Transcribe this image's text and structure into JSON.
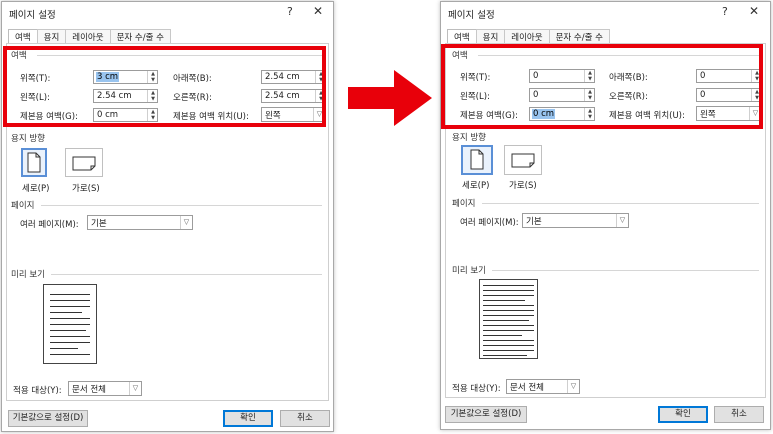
{
  "colors": {
    "highlight": "#e8000a",
    "arrow": "#e8000a",
    "selected_text": "#99c4ef",
    "default_button_border": "#0078d7"
  },
  "left_dialog": {
    "title": "페이지 설정",
    "help": "?",
    "close": "✕",
    "tabs": [
      "여백",
      "용지",
      "레이아웃",
      "문자 수/줄 수"
    ],
    "margins": {
      "group": "여백",
      "top_label": "위쪽(T):",
      "top_value": "3 cm",
      "bottom_label": "아래쪽(B):",
      "bottom_value": "2.54 cm",
      "left_label": "왼쪽(L):",
      "left_value": "2.54 cm",
      "right_label": "오른쪽(R):",
      "right_value": "2.54 cm",
      "gutter_label": "제본용 여백(G):",
      "gutter_value": "0 cm",
      "gutter_pos_label": "제본용 여백 위치(U):",
      "gutter_pos_value": "왼쪽"
    },
    "orientation": {
      "group": "용지 방향",
      "portrait": "세로(P)",
      "landscape": "가로(S)"
    },
    "pages": {
      "group": "페이지",
      "multiple_label": "여러 페이지(M):",
      "multiple_value": "기본"
    },
    "preview": {
      "group": "미리 보기"
    },
    "apply_label": "적용 대상(Y):",
    "apply_value": "문서 전체",
    "default_button": "기본값으로 설정(D)",
    "ok": "확인",
    "cancel": "취소"
  },
  "right_dialog": {
    "title": "페이지 설정",
    "help": "?",
    "close": "✕",
    "tabs": [
      "여백",
      "용지",
      "레이아웃",
      "문자 수/줄 수"
    ],
    "margins": {
      "group": "여백",
      "top_label": "위쪽(T):",
      "top_value": "0",
      "bottom_label": "아래쪽(B):",
      "bottom_value": "0",
      "left_label": "왼쪽(L):",
      "left_value": "0",
      "right_label": "오른쪽(R):",
      "right_value": "0",
      "gutter_label": "제본용 여백(G):",
      "gutter_value": "0 cm",
      "gutter_pos_label": "제본용 여백 위치(U):",
      "gutter_pos_value": "왼쪽"
    },
    "orientation": {
      "group": "용지 방향",
      "portrait": "세로(P)",
      "landscape": "가로(S)"
    },
    "pages": {
      "group": "페이지",
      "multiple_label": "여러 페이지(M):",
      "multiple_value": "기본"
    },
    "preview": {
      "group": "미리 보기"
    },
    "apply_label": "적용 대상(Y):",
    "apply_value": "문서 전체",
    "default_button": "기본값으로 설정(D)",
    "ok": "확인",
    "cancel": "취소"
  }
}
